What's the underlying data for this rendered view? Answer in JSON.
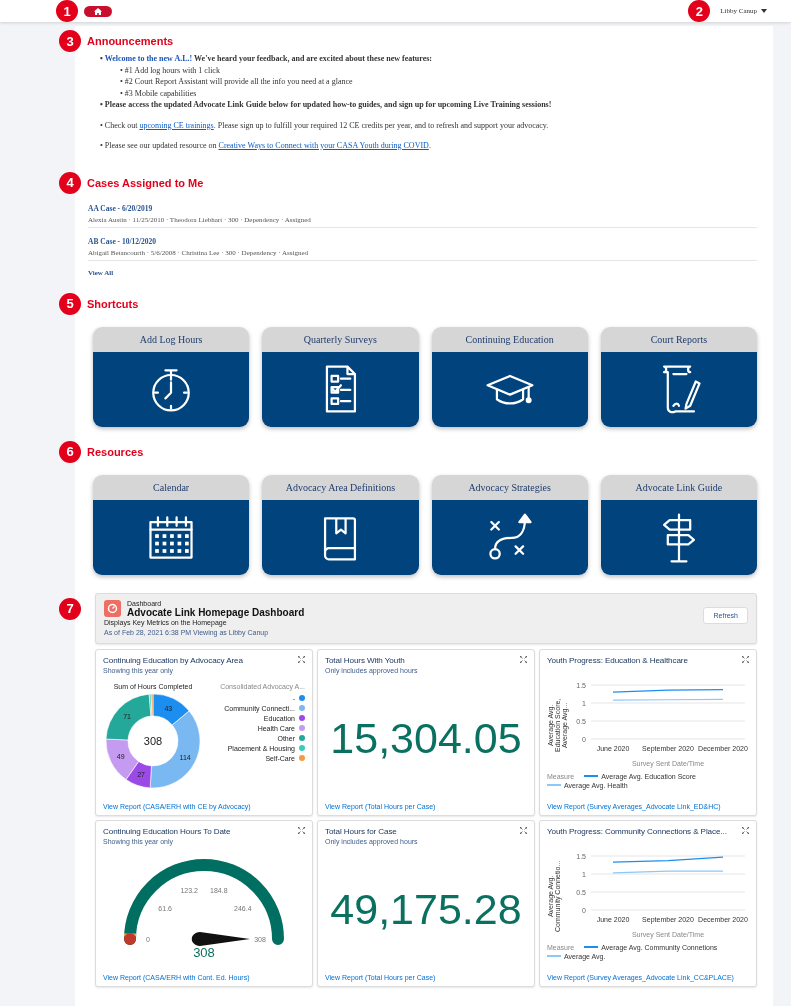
{
  "topbar": {
    "marker": "1",
    "user_marker": "2",
    "user": "Libby Canup"
  },
  "announcements": {
    "marker": "3",
    "title": "Announcements",
    "paragraphs": [
      [
        {
          "bullet": "•",
          "bold": true,
          "parts": [
            {
              "kind": "lead",
              "text": "Welcome to the new A.L.!"
            },
            {
              "kind": "plain",
              "text": " We've heard your feedback, and are excited about these new features:"
            }
          ],
          "children": [
            {
              "bullet": "•",
              "bold": false,
              "parts": [
                {
                  "kind": "plain",
                  "text": "#1 Add log hours with 1 click"
                }
              ]
            },
            {
              "bullet": "•",
              "bold": false,
              "parts": [
                {
                  "kind": "plain",
                  "text": "#2 Court Report Assistant will provide all the info you need at a glance"
                }
              ]
            },
            {
              "bullet": "•",
              "bold": false,
              "parts": [
                {
                  "kind": "plain",
                  "text": "#3 Mobile capabilities"
                }
              ]
            }
          ]
        },
        {
          "bullet": "•",
          "bold": true,
          "parts": [
            {
              "kind": "plain",
              "text": "Please access the updated Advocate Link Guide below for updated how-to guides, and sign up for upcoming Live Training sessions!"
            }
          ]
        }
      ],
      [
        {
          "bullet": "•",
          "bold": false,
          "parts": [
            {
              "kind": "plain",
              "text": "Check out "
            },
            {
              "kind": "link",
              "text": "upcoming CE trainings"
            },
            {
              "kind": "plain",
              "text": ".  Please sign up to fulfill your required 12 CE credits per year, and to refresh and support your advocacy."
            }
          ]
        }
      ],
      [
        {
          "bullet": "•",
          "bold": false,
          "parts": [
            {
              "kind": "plain",
              "text": "Please see our updated resource on "
            },
            {
              "kind": "link",
              "text": "Creative Ways to Connect with your  CASA Youth during COVID"
            },
            {
              "kind": "plain",
              "text": "."
            }
          ]
        }
      ]
    ]
  },
  "cases": {
    "marker": "4",
    "title": "Cases Assigned to Me",
    "items": [
      {
        "title": "AA Case - 6/20/2019",
        "details": "Alexia Austin · 11/25/2010 · Theodora Liebhart · 300 · Dependency · Assigned"
      },
      {
        "title": "AB Case - 10/12/2020",
        "details": "Abigail Betancourth · 5/6/2008 · Christina Lee · 300 · Dependency · Assigned"
      }
    ],
    "view_all": "View All"
  },
  "shortcuts": {
    "marker": "5",
    "title": "Shortcuts",
    "tiles": [
      {
        "label": "Add Log Hours"
      },
      {
        "label": "Quarterly Surveys"
      },
      {
        "label": "Continuing Education"
      },
      {
        "label": "Court Reports"
      }
    ]
  },
  "resources": {
    "marker": "6",
    "title": "Resources",
    "tiles": [
      {
        "label": "Calendar"
      },
      {
        "label": "Advocacy Area Definitions"
      },
      {
        "label": "Advocacy Strategies"
      },
      {
        "label": "Advocate Link Guide"
      }
    ]
  },
  "dashboard": {
    "marker": "7",
    "header": {
      "kind_label": "Dashboard",
      "title": "Advocate Link Homepage Dashboard",
      "description": "Displays Key Metrics on the Homepage",
      "as_of": "As of Feb 28, 2021 6:38 PM Viewing as Libby Canup",
      "button": "Refresh"
    },
    "cards": [
      {
        "kind": "donut",
        "title": "Continuing Education by Advocacy Area",
        "subtitle": "Showing this year only",
        "legend_title": "Consolidated Advocacy A...",
        "total": "308",
        "chart_data": {
          "type": "donut",
          "title": "Sum of Hours Completed",
          "categories": [
            "-",
            "Community Connecti...",
            "Education",
            "Health Care",
            "Other",
            "Placement & Housing",
            "Self-Care"
          ],
          "values": [
            43,
            114,
            27,
            49,
            71,
            2,
            2
          ],
          "colors": [
            "#1b8ef0",
            "#7ab8f2",
            "#9b4ae8",
            "#c49bf0",
            "#24a89a",
            "#3dc9c0",
            "#f59a42"
          ],
          "value_labels": [
            "43",
            "114",
            "27",
            "49",
            "71",
            null,
            null
          ]
        },
        "link": "View Report (CASA/ERH with CE by Advocacy)"
      },
      {
        "kind": "metric",
        "title": "Total Hours With Youth",
        "subtitle": "Only includes approved hours",
        "value": "15,304.05",
        "link": "View Report (Total Hours per Case)"
      },
      {
        "kind": "line",
        "title": "Youth Progress: Education & Healthcare",
        "legend_title": "Measure",
        "chart_data": {
          "type": "line",
          "xlabel": "Survey Sent Date/Time",
          "ylabel": "Average Avg. Education Score, Average Avg...",
          "categories": [
            "June 2020",
            "September 2020",
            "December 2020"
          ],
          "ylim": [
            0,
            1.5
          ],
          "yticks": [
            0,
            0.5,
            1,
            1.5
          ],
          "series": [
            {
              "name": "Average Avg. Education Score",
              "color": "#1b8ef0",
              "values": [
                1.3,
                1.36,
                1.37
              ]
            },
            {
              "name": "Average Avg. Health",
              "color": "#8ec8f7",
              "values": [
                1.08,
                1.09,
                1.1
              ]
            }
          ]
        },
        "link": "View Report (Survey Averages_Advocate Link_ED&HC)"
      },
      {
        "kind": "gauge",
        "title": "Continuing Education Hours To Date",
        "subtitle": "Showing this year only",
        "ticks": [
          "0",
          "61.6",
          "123.2",
          "184.8",
          "246.4",
          "308"
        ],
        "value": "308",
        "link": "View Report (CASA/ERH with Cont. Ed. Hours)"
      },
      {
        "kind": "metric",
        "title": "Total Hours for Case",
        "subtitle": "Only includes approved hours",
        "value": "49,175.28",
        "link": "View Report (Total Hours per Case)"
      },
      {
        "kind": "line",
        "title": "Youth Progress: Community Connections & Place...",
        "legend_title": "Measure",
        "chart_data": {
          "type": "line",
          "xlabel": "Survey Sent Date/Time",
          "ylabel": "Average Avg. Community Connetio...",
          "categories": [
            "June 2020",
            "September 2020",
            "December 2020"
          ],
          "ylim": [
            0,
            1.5
          ],
          "yticks": [
            0,
            0.5,
            1,
            1.5
          ],
          "series": [
            {
              "name": "Average Avg. Community Connetions",
              "color": "#1b8ef0",
              "values": [
                1.33,
                1.37,
                1.47
              ]
            },
            {
              "name": "Average Avg.",
              "color": "#8ec8f7",
              "values": [
                1.03,
                1.08,
                1.08
              ]
            }
          ]
        },
        "link": "View Report (Survey Averages_Advocate Link_CC&PLACE)"
      }
    ]
  }
}
